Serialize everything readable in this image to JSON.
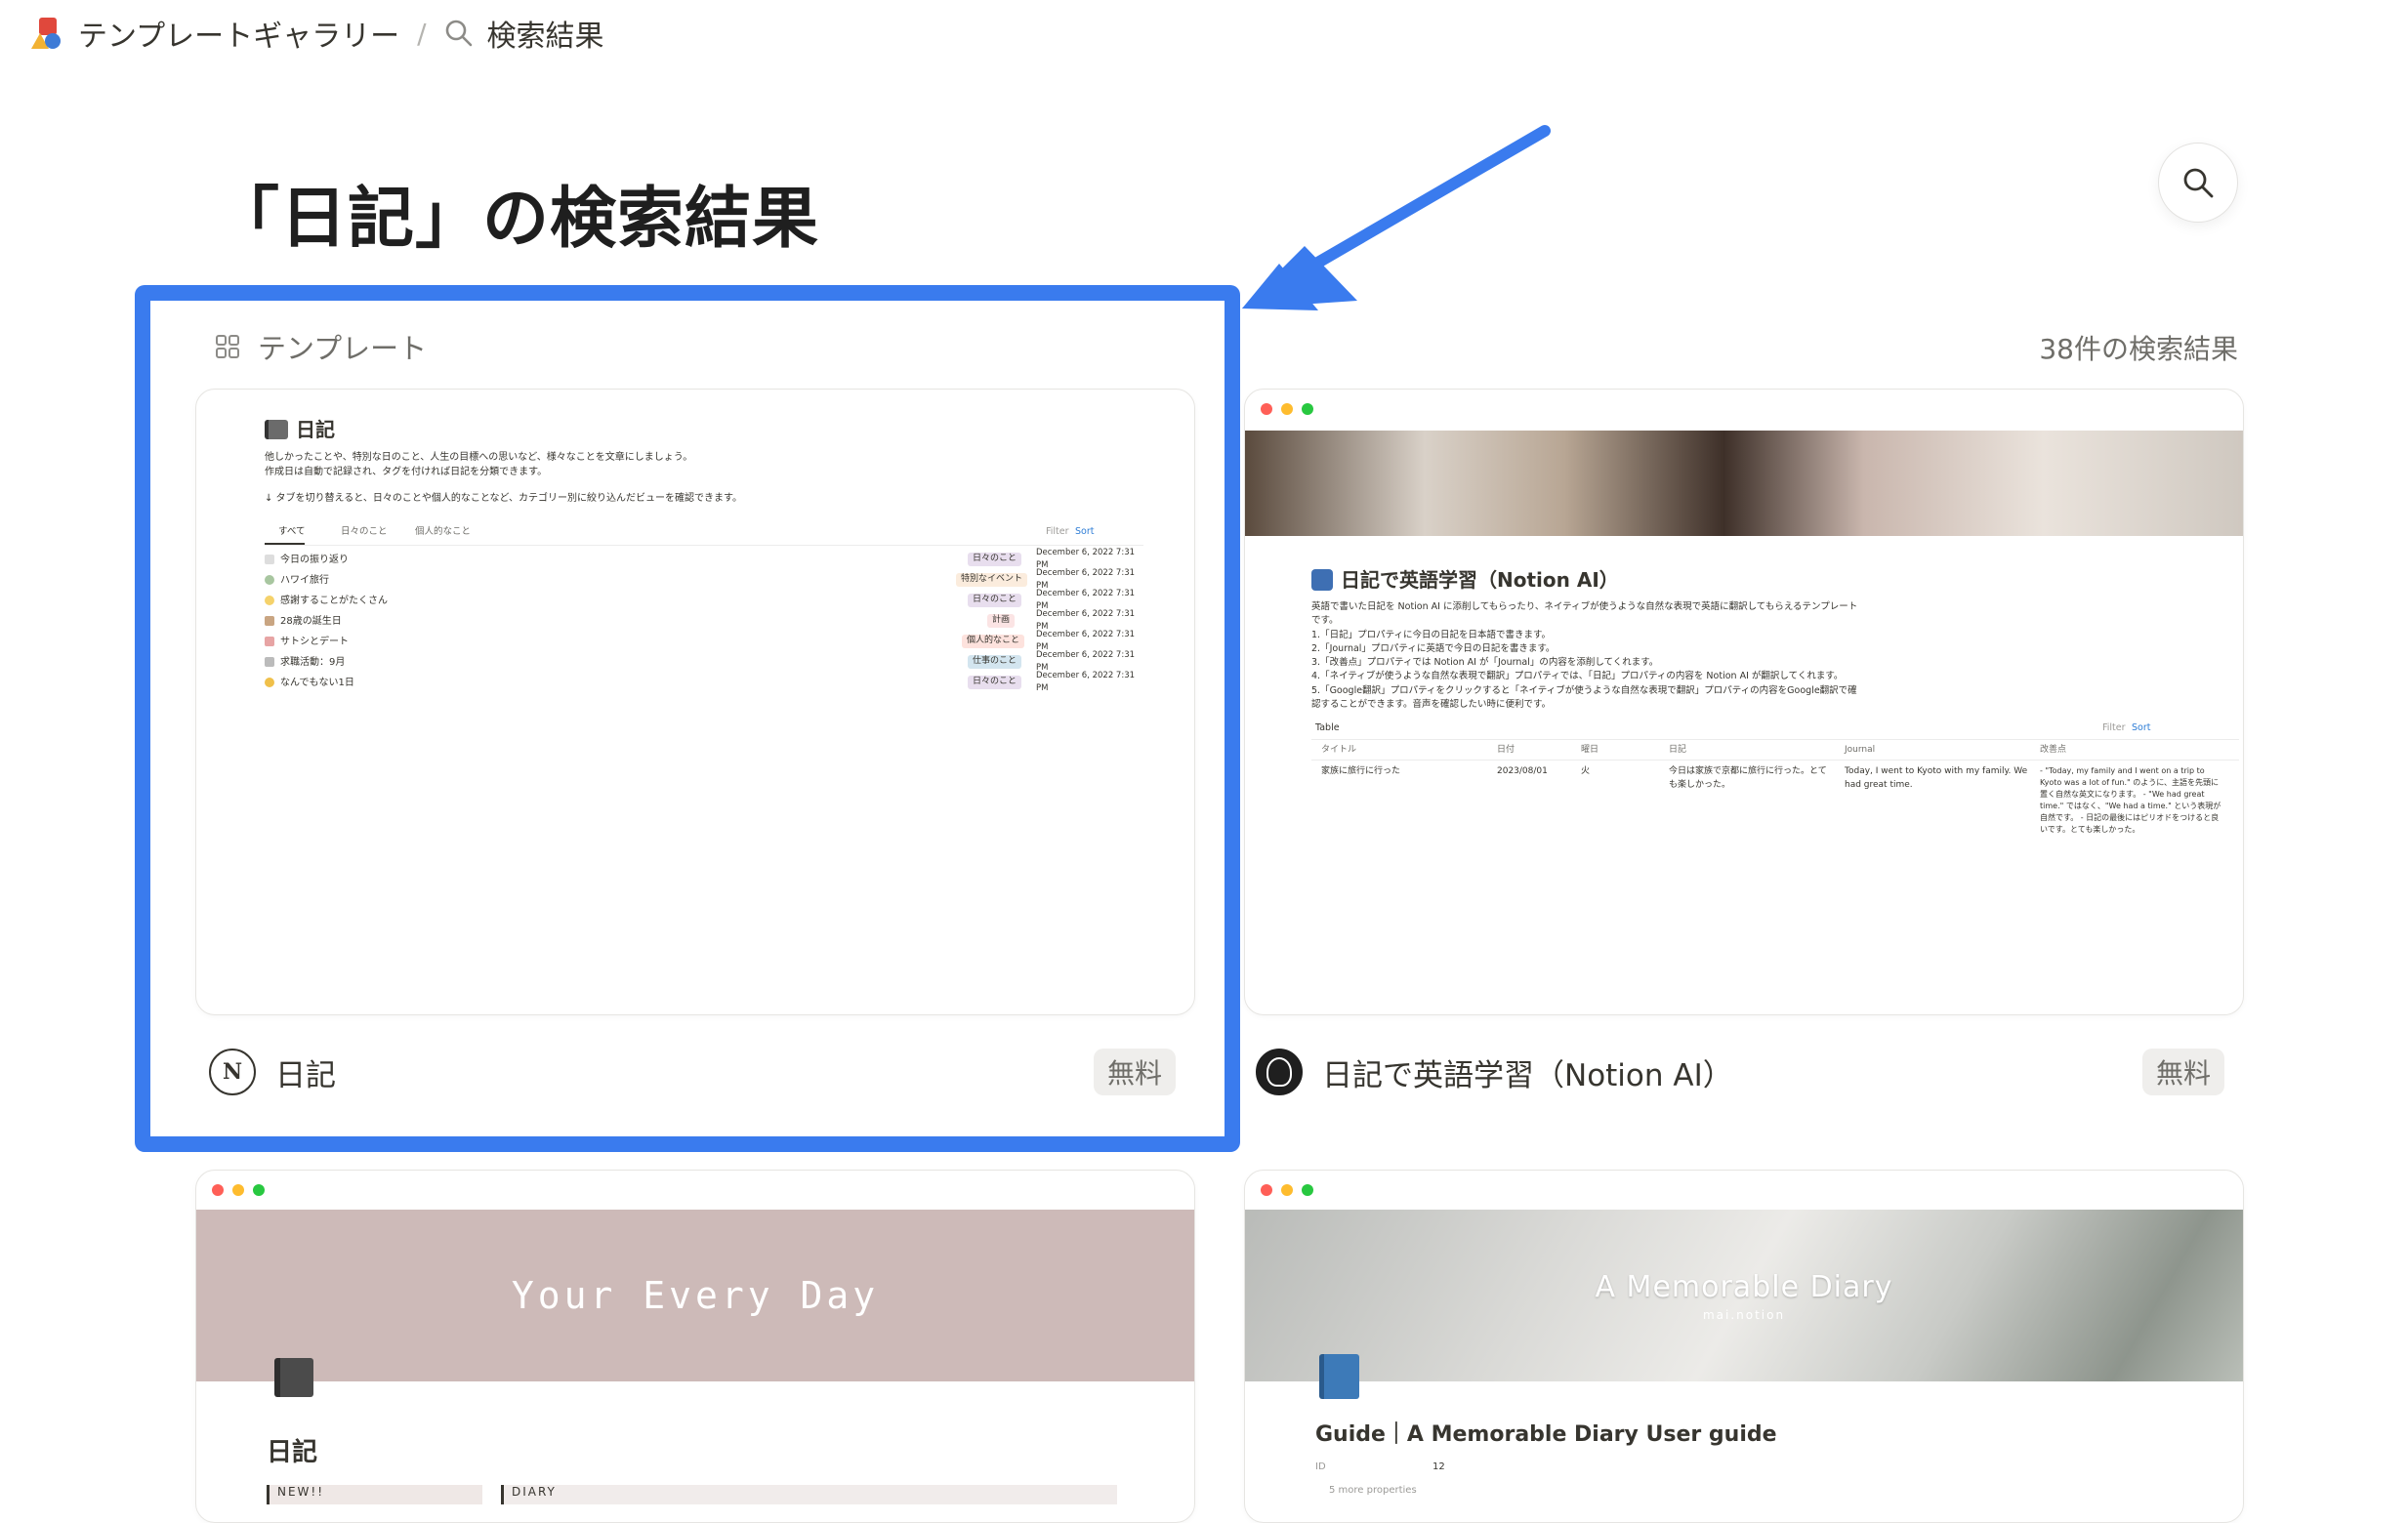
{
  "breadcrumb": {
    "gallery": "テンプレートギャラリー",
    "separator": "/",
    "current": "検索結果"
  },
  "page": {
    "title": "「日記」の検索結果",
    "section": "テンプレート",
    "result_count": "38件の検索結果"
  },
  "cards": [
    {
      "name": "日記",
      "price": "無料",
      "preview": {
        "title": "日記",
        "desc1": "他しかったことや、特別な日のこと、人生の目標への思いなど、様々なことを文章にしましょう。",
        "desc2": "作成日は自動で記録され、タグを付ければ日記を分類できます。",
        "desc3": "↓ タブを切り替えると、日々のことや個人的なことなど、カテゴリー別に絞り込んだビューを確認できます。",
        "tabs": [
          "すべて",
          "日々のこと",
          "個人的なこと"
        ],
        "toolbar": [
          "Filter",
          "Sort"
        ],
        "rows": [
          {
            "title": "今日の振り返り",
            "tag": "日々のこと",
            "tag_color": "#e8deee",
            "date": "December 6, 2022 7:31 PM"
          },
          {
            "title": "ハワイ旅行",
            "tag": "特別なイベント",
            "tag_color": "#fbecdd",
            "date": "December 6, 2022 7:31 PM"
          },
          {
            "title": "感謝することがたくさん",
            "tag": "日々のこと",
            "tag_color": "#e8deee",
            "date": "December 6, 2022 7:31 PM"
          },
          {
            "title": "28歳の誕生日",
            "tag": "計画",
            "tag_color": "#fbe4e4",
            "date": "December 6, 2022 7:31 PM"
          },
          {
            "title": "サトシとデート",
            "tag": "個人的なこと",
            "tag_color": "#fde2dd",
            "date": "December 6, 2022 7:31 PM"
          },
          {
            "title": "求職活動：9月",
            "tag": "仕事のこと",
            "tag_color": "#d3e5ef",
            "date": "December 6, 2022 7:31 PM"
          },
          {
            "title": "なんでもない1日",
            "tag": "日々のこと",
            "tag_color": "#e8deee",
            "date": "December 6, 2022 7:31 PM"
          }
        ]
      }
    },
    {
      "name": "日記で英語学習（Notion AI）",
      "price": "無料",
      "preview": {
        "title": "日記で英語学習（Notion AI）",
        "desc": [
          "英語で書いた日記を Notion AI に添削してもらったり、ネイティブが使うような自然な表現で英語に翻訳してもらえるテンプレートです。",
          "1.「日記」プロパティに今日の日記を日本語で書きます。",
          "2.「Journal」プロパティに英語で今日の日記を書きます。",
          "3.「改善点」プロパティでは Notion AI が「Journal」の内容を添削してくれます。",
          "4.「ネイティブが使うような自然な表現で翻訳」プロパティでは、「日記」プロパティの内容を Notion AI が翻訳してくれます。",
          "5.「Google翻訳」プロパティをクリックすると「ネイティブが使うような自然な表現で翻訳」プロパティの内容をGoogle翻訳で確認することができます。音声を確認したい時に便利です。"
        ],
        "view": "Table",
        "toolbar": [
          "Filter",
          "Sort"
        ],
        "columns": [
          "タイトル",
          "日付",
          "曜日",
          "日記",
          "Journal",
          "改善点"
        ],
        "row": {
          "title": "家族に旅行に行った",
          "date": "2023/08/01",
          "weekday": "火",
          "diary": "今日は家族で京都に旅行に行った。とても楽しかった。",
          "journal": "Today, I went to Kyoto with my family. We had great time.",
          "fix": "- \"Today, my family and I went on a trip to Kyoto was a lot of fun.\" のように、主語を先頭に置く自然な英文になります。 - \"We had great time.\" ではなく、\"We had a time.\" という表現が自然です。 - 日記の最後にはピリオドをつけると良いです。とても楽しかった。"
        }
      }
    },
    {
      "preview": {
        "banner": "Your Every Day",
        "title": "日記",
        "col1": "NEW!!",
        "col2": "DIARY"
      }
    },
    {
      "preview": {
        "banner": "A Memorable Diary",
        "banner_sub": "mai.notion",
        "title": "Guide｜A Memorable Diary  User guide",
        "prop": "ID",
        "prop_value": "12",
        "more": "5 more properties"
      }
    }
  ],
  "colors": {
    "highlight": "#3a7bee",
    "arrow": "#3a7bee",
    "banner_pink": "#cdbab8"
  },
  "icons": [
    "gallery-logo-icon",
    "search-icon",
    "grid-icon",
    "notion-icon",
    "avatar-icon",
    "arrow-annotation"
  ]
}
